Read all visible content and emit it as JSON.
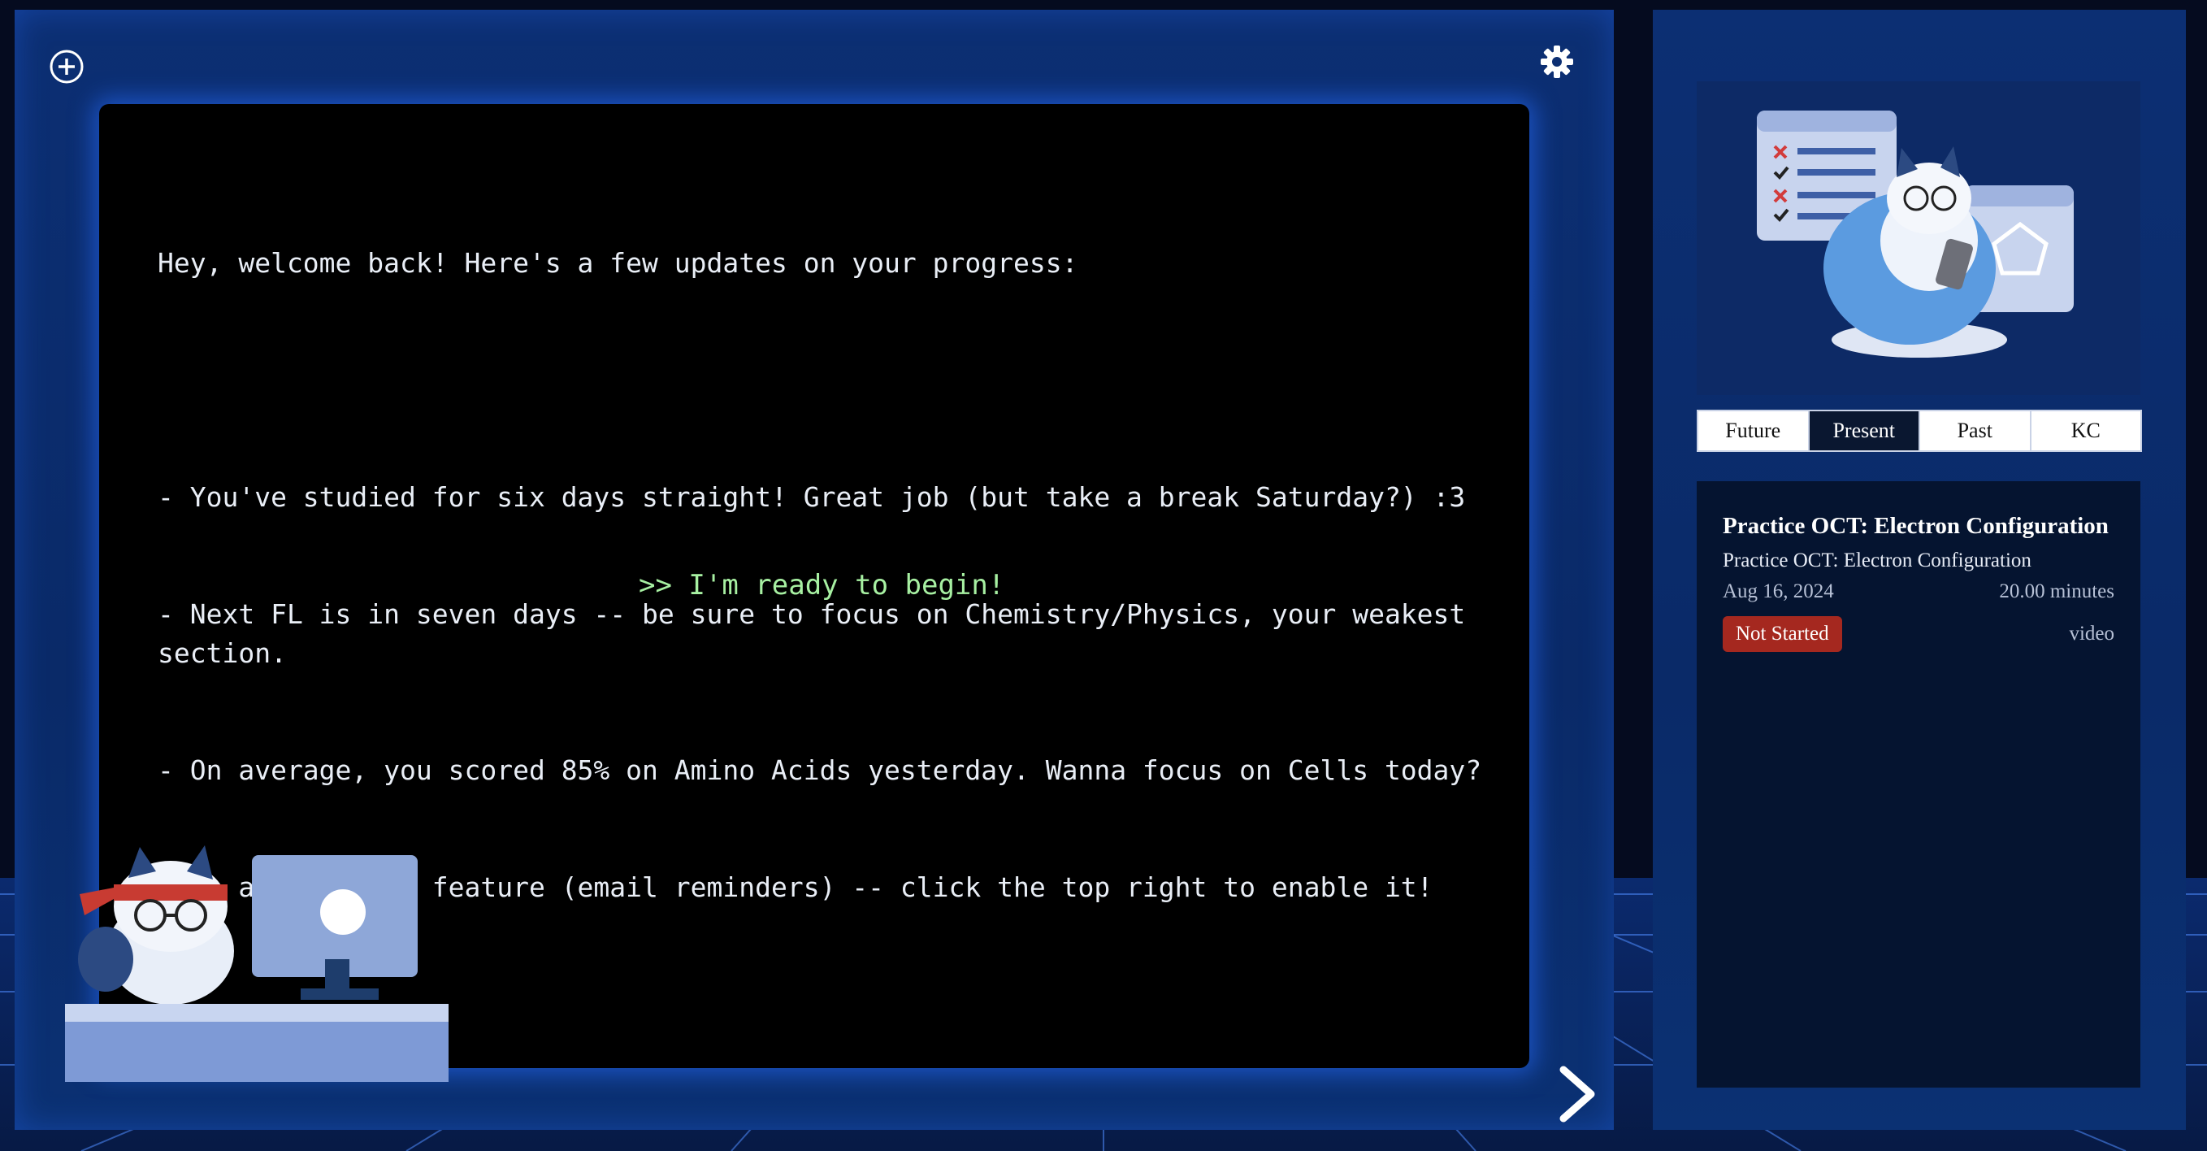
{
  "terminal": {
    "lines": [
      "Hey, welcome back! Here's a few updates on your progress:",
      "",
      "- You've studied for six days straight! Great job (but take a break Saturday?) :3",
      "- Next FL is in seven days -- be sure to focus on Chemistry/Physics, your weakest section.",
      "- On average, you scored 85% on Amino Acids yesterday. Wanna focus on Cells today?",
      "- We added a new feature (email reminders) -- click the top right to enable it!"
    ],
    "begin_label": ">> I'm ready to begin!"
  },
  "icons": {
    "add": "plus-circle-icon",
    "settings": "gear-icon",
    "next": "chevron-right-icon"
  },
  "tabs": [
    "Future",
    "Present",
    "Past",
    "KC"
  ],
  "active_tab": "Present",
  "task": {
    "title": "Practice OCT: Electron Configuration",
    "subtitle": "Practice OCT: Electron Configuration",
    "date": "Aug 16, 2024",
    "duration": "20.00 minutes",
    "status": "Not Started",
    "type": "video"
  },
  "colors": {
    "accent": "#a7f0a2",
    "status_not_started": "#a5281f",
    "panel": "#0a2a68"
  }
}
